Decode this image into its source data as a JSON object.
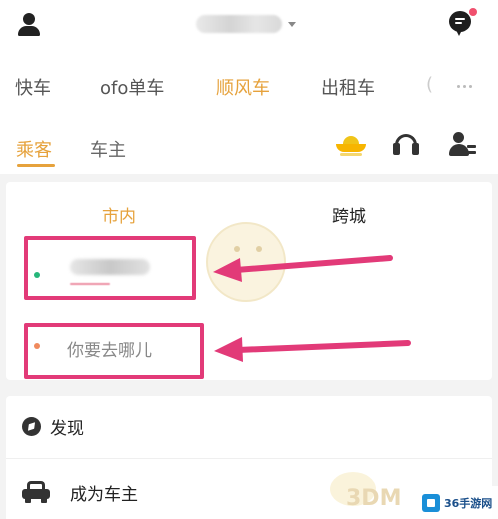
{
  "header": {
    "user_icon": "person-icon",
    "city_label": "",
    "message_icon": "message-bubble-icon",
    "message_badge_color": "#f0506e"
  },
  "services": {
    "tabs": [
      {
        "label": "快车",
        "active": false
      },
      {
        "label": "ofo单车",
        "active": false
      },
      {
        "label": "顺风车",
        "active": true
      },
      {
        "label": "出租车",
        "active": false
      },
      {
        "label": "(",
        "active": false
      }
    ],
    "more_icon": "more-dots-icon"
  },
  "roles": {
    "passenger": "乘客",
    "driver": "车主",
    "active": "passenger",
    "icons": [
      "gold-ingot-icon",
      "headset-icon",
      "driver-profile-icon"
    ]
  },
  "trip": {
    "tabs": {
      "local": "市内",
      "intercity": "跨城"
    },
    "active_tab": "local",
    "from_value": "",
    "to_placeholder": "你要去哪儿"
  },
  "discover": {
    "title": "发现",
    "items": [
      {
        "label": "成为车主",
        "icon": "car-icon"
      }
    ]
  },
  "watermarks": {
    "mid_logo": "3DM",
    "corner_logo": "36手游网"
  },
  "colors": {
    "accent": "#e6a23c",
    "annotation": "#e23a78",
    "from_dot": "#26b67a",
    "to_dot": "#f08a5d"
  }
}
